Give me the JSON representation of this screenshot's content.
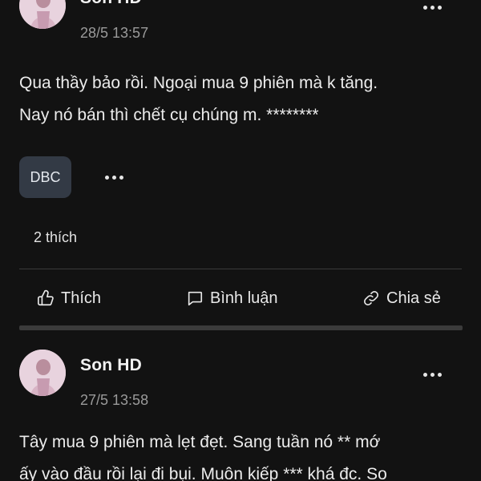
{
  "posts": [
    {
      "author": "Son HD",
      "time": "28/5 13:57",
      "body": "Qua thầy bảo rồi. Ngoại mua 9 phiên mà k tăng.\nNay nó bán thì chết cụ chúng m. ********",
      "tag": "DBC",
      "likes": "2 thích"
    },
    {
      "author": "Son HD",
      "time": "27/5 13:58",
      "body": "Tây mua 9 phiên mà lẹt đẹt. Sang tuần nó ** mớ\nấy vào đầu rồi lại đi bụi. Muôn kiếp *** khá đc. So"
    }
  ],
  "actions": {
    "like": "Thích",
    "comment": "Bình luận",
    "share": "Chia sẻ"
  },
  "icons": {
    "more": "more-horizontal-icon",
    "like": "thumbs-up-icon",
    "comment": "comment-icon",
    "share": "link-icon"
  }
}
